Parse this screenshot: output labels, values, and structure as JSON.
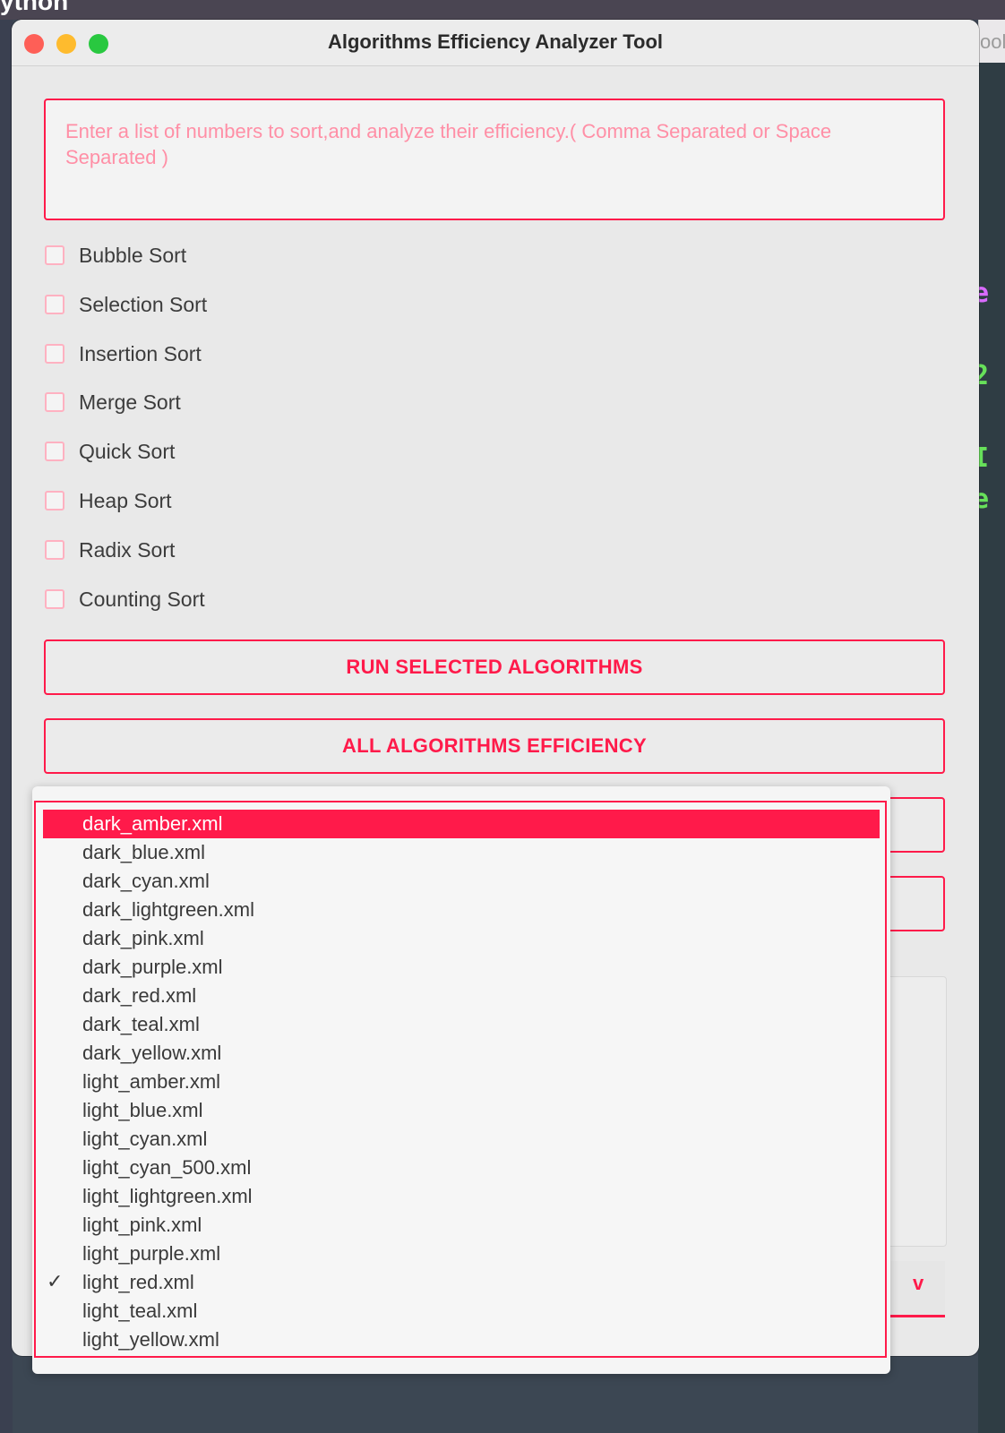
{
  "desktop": {
    "top_text": "ython",
    "right_window_text": "ool",
    "terminal_fragments": [
      {
        "text": "te",
        "color": "#d96bff"
      },
      {
        "text": "2",
        "color": "#67e05a"
      },
      {
        "text": "NI",
        "color": "#67e05a"
      },
      {
        "text": "te",
        "color": "#67e05a"
      }
    ]
  },
  "window": {
    "title": "Algorithms Efficiency Analyzer Tool"
  },
  "input": {
    "value": "",
    "placeholder": "Enter a list of numbers to sort,and analyze their efficiency.( Comma Separated or Space Separated )"
  },
  "algorithms": [
    {
      "label": "Bubble Sort",
      "checked": false
    },
    {
      "label": "Selection Sort",
      "checked": false
    },
    {
      "label": "Insertion Sort",
      "checked": false
    },
    {
      "label": "Merge Sort",
      "checked": false
    },
    {
      "label": "Quick Sort",
      "checked": false
    },
    {
      "label": "Heap Sort",
      "checked": false
    },
    {
      "label": "Radix Sort",
      "checked": false
    },
    {
      "label": "Counting Sort",
      "checked": false
    }
  ],
  "buttons": {
    "run": "RUN SELECTED ALGORITHMS",
    "all": "ALL ALGORITHMS EFFICIENCY"
  },
  "theme_dropdown": {
    "highlighted": "dark_amber.xml",
    "checked": "light_red.xml",
    "options": [
      "dark_amber.xml",
      "dark_blue.xml",
      "dark_cyan.xml",
      "dark_lightgreen.xml",
      "dark_pink.xml",
      "dark_purple.xml",
      "dark_red.xml",
      "dark_teal.xml",
      "dark_yellow.xml",
      "light_amber.xml",
      "light_blue.xml",
      "light_cyan.xml",
      "light_cyan_500.xml",
      "light_lightgreen.xml",
      "light_pink.xml",
      "light_purple.xml",
      "light_red.xml",
      "light_teal.xml",
      "light_yellow.xml"
    ],
    "check_glyph": "✓",
    "arrow_glyph": "v"
  },
  "colors": {
    "accent": "#ff1a4a"
  }
}
